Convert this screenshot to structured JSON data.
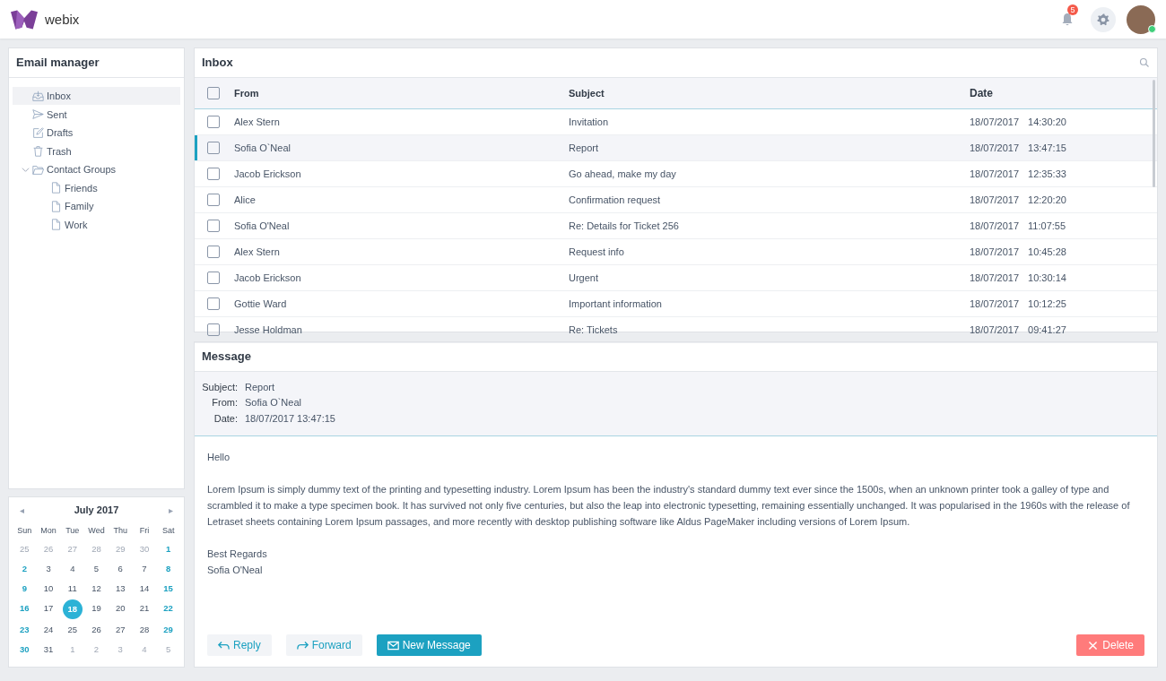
{
  "header": {
    "logo_text": "webix",
    "notifications": "5"
  },
  "sidebar": {
    "title": "Email manager",
    "items": [
      {
        "label": "Inbox",
        "kind": "inbox",
        "selected": true
      },
      {
        "label": "Sent",
        "kind": "sent",
        "selected": false
      },
      {
        "label": "Drafts",
        "kind": "drafts",
        "selected": false
      },
      {
        "label": "Trash",
        "kind": "trash",
        "selected": false
      },
      {
        "label": "Contact Groups",
        "kind": "group",
        "selected": false,
        "expanded": true,
        "children": [
          {
            "label": "Friends",
            "selected": false
          },
          {
            "label": "Family",
            "selected": false
          },
          {
            "label": "Work",
            "selected": false
          }
        ]
      }
    ]
  },
  "calendar": {
    "month": "July 2017",
    "prev": "◂",
    "next": "▸",
    "weekdays": [
      "Sun",
      "Mon",
      "Tue",
      "Wed",
      "Thu",
      "Fri",
      "Sat"
    ],
    "days": [
      {
        "label": "25",
        "kind": "other",
        "selected": false
      },
      {
        "label": "26",
        "kind": "other",
        "selected": false
      },
      {
        "label": "27",
        "kind": "other",
        "selected": false
      },
      {
        "label": "28",
        "kind": "other",
        "selected": false
      },
      {
        "label": "29",
        "kind": "other",
        "selected": false
      },
      {
        "label": "30",
        "kind": "other",
        "selected": false
      },
      {
        "label": "1",
        "kind": "weekend",
        "selected": false
      },
      {
        "label": "2",
        "kind": "weekend",
        "selected": false
      },
      {
        "label": "3",
        "kind": "day",
        "selected": false
      },
      {
        "label": "4",
        "kind": "day",
        "selected": false
      },
      {
        "label": "5",
        "kind": "day",
        "selected": false
      },
      {
        "label": "6",
        "kind": "day",
        "selected": false
      },
      {
        "label": "7",
        "kind": "day",
        "selected": false
      },
      {
        "label": "8",
        "kind": "weekend",
        "selected": false
      },
      {
        "label": "9",
        "kind": "weekend",
        "selected": false
      },
      {
        "label": "10",
        "kind": "day",
        "selected": false
      },
      {
        "label": "11",
        "kind": "day",
        "selected": false
      },
      {
        "label": "12",
        "kind": "day",
        "selected": false
      },
      {
        "label": "13",
        "kind": "day",
        "selected": false
      },
      {
        "label": "14",
        "kind": "day",
        "selected": false
      },
      {
        "label": "15",
        "kind": "weekend",
        "selected": false
      },
      {
        "label": "16",
        "kind": "weekend",
        "selected": false
      },
      {
        "label": "17",
        "kind": "day",
        "selected": false
      },
      {
        "label": "18",
        "kind": "day",
        "selected": true
      },
      {
        "label": "19",
        "kind": "day",
        "selected": false
      },
      {
        "label": "20",
        "kind": "day",
        "selected": false
      },
      {
        "label": "21",
        "kind": "day",
        "selected": false
      },
      {
        "label": "22",
        "kind": "weekend",
        "selected": false
      },
      {
        "label": "23",
        "kind": "weekend",
        "selected": false
      },
      {
        "label": "24",
        "kind": "day",
        "selected": false
      },
      {
        "label": "25",
        "kind": "day",
        "selected": false
      },
      {
        "label": "26",
        "kind": "day",
        "selected": false
      },
      {
        "label": "27",
        "kind": "day",
        "selected": false
      },
      {
        "label": "28",
        "kind": "day",
        "selected": false
      },
      {
        "label": "29",
        "kind": "weekend",
        "selected": false
      },
      {
        "label": "30",
        "kind": "weekend",
        "selected": false
      },
      {
        "label": "31",
        "kind": "day",
        "selected": false
      },
      {
        "label": "1",
        "kind": "other",
        "selected": false
      },
      {
        "label": "2",
        "kind": "other",
        "selected": false
      },
      {
        "label": "3",
        "kind": "other",
        "selected": false
      },
      {
        "label": "4",
        "kind": "other",
        "selected": false
      },
      {
        "label": "5",
        "kind": "other",
        "selected": false
      }
    ]
  },
  "inbox": {
    "title": "Inbox",
    "columns": [
      "From",
      "Subject",
      "Date"
    ],
    "header_checked": false,
    "rows": [
      {
        "from": "Alex Stern",
        "subject": "Invitation",
        "date": "18/07/2017",
        "time": "14:30:20",
        "checked": false,
        "selected": false
      },
      {
        "from": "Sofia O`Neal",
        "subject": "Report",
        "date": "18/07/2017",
        "time": "13:47:15",
        "checked": false,
        "selected": true
      },
      {
        "from": "Jacob Erickson",
        "subject": "Go ahead, make my day",
        "date": "18/07/2017",
        "time": "12:35:33",
        "checked": false,
        "selected": false
      },
      {
        "from": "Alice",
        "subject": "Confirmation request",
        "date": "18/07/2017",
        "time": "12:20:20",
        "checked": false,
        "selected": false
      },
      {
        "from": "Sofia O'Neal",
        "subject": "Re: Details for Ticket 256",
        "date": "18/07/2017",
        "time": "11:07:55",
        "checked": false,
        "selected": false
      },
      {
        "from": "Alex Stern",
        "subject": "Request info",
        "date": "18/07/2017",
        "time": "10:45:28",
        "checked": false,
        "selected": false
      },
      {
        "from": "Jacob Erickson",
        "subject": "Urgent",
        "date": "18/07/2017",
        "time": "10:30:14",
        "checked": false,
        "selected": false
      },
      {
        "from": "Gottie Ward",
        "subject": "Important information",
        "date": "18/07/2017",
        "time": "10:12:25",
        "checked": false,
        "selected": false
      },
      {
        "from": "Jesse Holdman",
        "subject": "Re: Tickets",
        "date": "18/07/2017",
        "time": "09:41:27",
        "checked": false,
        "selected": false
      }
    ]
  },
  "message": {
    "title": "Message",
    "fields": [
      {
        "label": "Subject:",
        "value": "Report"
      },
      {
        "label": "From:",
        "value": "Sofia O`Neal"
      },
      {
        "label": "Date:",
        "value": "18/07/2017  13:47:15"
      }
    ],
    "greeting": "Hello",
    "body": "Lorem Ipsum is simply dummy text of the printing and typesetting industry. Lorem Ipsum has been the industry's standard dummy text ever since the 1500s, when an unknown printer took a galley of type and scrambled it to make a type specimen book. It has survived not only five centuries, but also the leap into electronic typesetting, remaining essentially unchanged. It was popularised in the 1960s with the release of Letraset sheets containing Lorem Ipsum passages, and more recently with desktop publishing software like Aldus PageMaker including versions of Lorem Ipsum.",
    "closing": [
      "Best Regards",
      "Sofia O'Neal"
    ],
    "buttons": [
      {
        "label": "Reply",
        "kind": "reply"
      },
      {
        "label": "Forward",
        "kind": "forward"
      },
      {
        "label": "New Message",
        "kind": "new"
      },
      {
        "label": "Delete",
        "kind": "delete"
      }
    ]
  }
}
